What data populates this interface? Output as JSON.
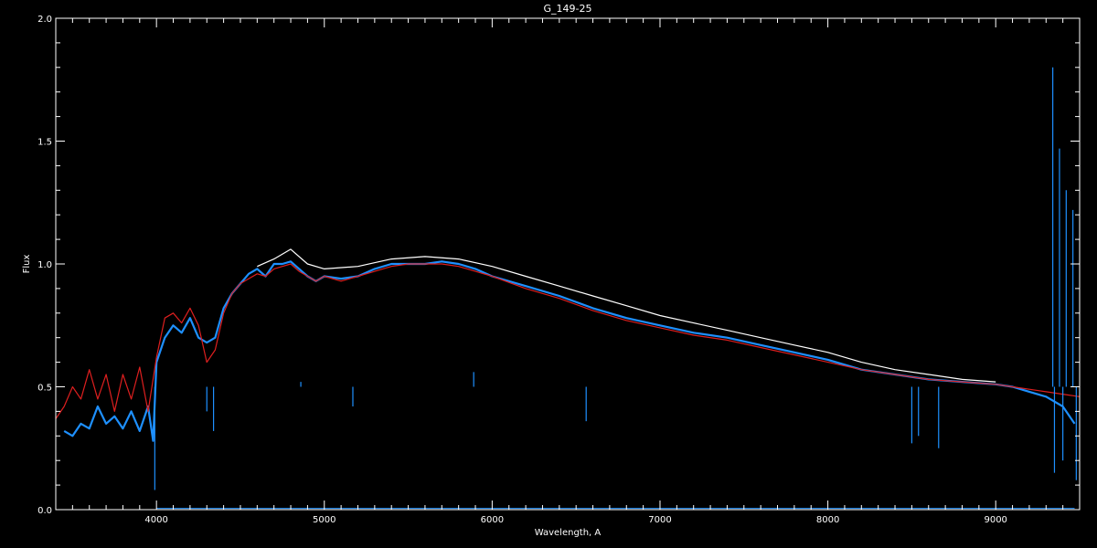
{
  "chart_data": {
    "type": "line",
    "title": "G_149-25",
    "xlabel": "Wavelength, A",
    "ylabel": "Flux",
    "xlim": [
      3400,
      9500
    ],
    "ylim": [
      0.0,
      2.0
    ],
    "x_ticks": [
      4000,
      5000,
      6000,
      7000,
      8000,
      9000
    ],
    "x_tick_labels": [
      "4000",
      "5000",
      "6000",
      "7000",
      "8000",
      "9000"
    ],
    "y_ticks": [
      0.0,
      0.5,
      1.0,
      1.5,
      2.0
    ],
    "y_tick_labels": [
      "0.0",
      "0.5",
      "1.0",
      "1.5",
      "2.0"
    ],
    "x_minor_step": 100,
    "y_minor_step": 0.1,
    "grid": false,
    "legend": "none",
    "colors": {
      "background": "#000000",
      "axes": "#ffffff",
      "observed": "#1e90ff",
      "model": "#dd1f1f",
      "continuum": "#ffffff"
    },
    "series": [
      {
        "color": "#1e90ff",
        "x": [
          3450,
          3500,
          3550,
          3600,
          3650,
          3700,
          3750,
          3800,
          3850,
          3900,
          3950,
          3980,
          4000,
          4050,
          4100,
          4150,
          4200,
          4250,
          4300,
          4350,
          4400,
          4450,
          4500,
          4550,
          4600,
          4650,
          4700,
          4750,
          4800,
          4850,
          4900,
          4950,
          5000,
          5100,
          5200,
          5300,
          5400,
          5500,
          5600,
          5700,
          5800,
          5900,
          6000,
          6200,
          6400,
          6600,
          6800,
          7000,
          7200,
          7400,
          7600,
          7800,
          8000,
          8200,
          8400,
          8600,
          8800,
          9000,
          9100,
          9200,
          9300,
          9400,
          9470
        ],
        "y": [
          0.32,
          0.3,
          0.35,
          0.33,
          0.42,
          0.35,
          0.38,
          0.33,
          0.4,
          0.32,
          0.42,
          0.28,
          0.6,
          0.7,
          0.75,
          0.72,
          0.78,
          0.7,
          0.68,
          0.7,
          0.82,
          0.88,
          0.92,
          0.96,
          0.98,
          0.95,
          1.0,
          1.0,
          1.01,
          0.98,
          0.95,
          0.93,
          0.95,
          0.94,
          0.95,
          0.98,
          1.0,
          1.0,
          1.0,
          1.01,
          1.0,
          0.98,
          0.95,
          0.91,
          0.87,
          0.82,
          0.78,
          0.75,
          0.72,
          0.7,
          0.67,
          0.64,
          0.61,
          0.57,
          0.55,
          0.53,
          0.52,
          0.51,
          0.5,
          0.48,
          0.46,
          0.42,
          0.35
        ]
      },
      {
        "color": "#dd1f1f",
        "x": [
          3400,
          3450,
          3500,
          3550,
          3600,
          3650,
          3700,
          3750,
          3800,
          3850,
          3900,
          3950,
          4000,
          4050,
          4100,
          4150,
          4200,
          4250,
          4300,
          4350,
          4400,
          4450,
          4500,
          4550,
          4600,
          4650,
          4700,
          4750,
          4800,
          4850,
          4900,
          4950,
          5000,
          5100,
          5200,
          5300,
          5400,
          5500,
          5600,
          5700,
          5800,
          5900,
          6000,
          6200,
          6400,
          6600,
          6800,
          7000,
          7200,
          7400,
          7600,
          7800,
          8000,
          8200,
          8400,
          8600,
          8800,
          9000,
          9100,
          9200,
          9300,
          9400,
          9500
        ],
        "y": [
          0.37,
          0.42,
          0.5,
          0.45,
          0.57,
          0.45,
          0.55,
          0.4,
          0.55,
          0.45,
          0.58,
          0.4,
          0.62,
          0.78,
          0.8,
          0.76,
          0.82,
          0.75,
          0.6,
          0.65,
          0.8,
          0.88,
          0.92,
          0.94,
          0.96,
          0.95,
          0.98,
          0.99,
          1.0,
          0.97,
          0.95,
          0.93,
          0.95,
          0.93,
          0.95,
          0.97,
          0.99,
          1.0,
          1.0,
          1.0,
          0.99,
          0.97,
          0.95,
          0.9,
          0.86,
          0.81,
          0.77,
          0.74,
          0.71,
          0.69,
          0.66,
          0.63,
          0.6,
          0.57,
          0.55,
          0.53,
          0.52,
          0.51,
          0.5,
          0.49,
          0.48,
          0.47,
          0.46
        ]
      },
      {
        "color": "#ffffff",
        "x": [
          4600,
          4700,
          4800,
          4900,
          5000,
          5200,
          5400,
          5600,
          5800,
          6000,
          6200,
          6400,
          6600,
          6800,
          7000,
          7200,
          7400,
          7600,
          7800,
          8000,
          8200,
          8400,
          8600,
          8800,
          9000
        ],
        "y": [
          0.99,
          1.02,
          1.06,
          1.0,
          0.98,
          0.99,
          1.02,
          1.03,
          1.02,
          0.99,
          0.95,
          0.91,
          0.87,
          0.83,
          0.79,
          0.76,
          0.73,
          0.7,
          0.67,
          0.64,
          0.6,
          0.57,
          0.55,
          0.53,
          0.52
        ]
      }
    ],
    "spikes": [
      {
        "x": 3990,
        "y": 0.08
      },
      {
        "x": 4300,
        "y": 0.4
      },
      {
        "x": 4340,
        "y": 0.32
      },
      {
        "x": 4860,
        "y": 0.52
      },
      {
        "x": 5170,
        "y": 0.42
      },
      {
        "x": 5180,
        "y": 0.5
      },
      {
        "x": 5890,
        "y": 0.56
      },
      {
        "x": 6560,
        "y": 0.36
      },
      {
        "x": 8500,
        "y": 0.27
      },
      {
        "x": 8540,
        "y": 0.3
      },
      {
        "x": 8660,
        "y": 0.25
      },
      {
        "x": 9340,
        "y": 1.8
      },
      {
        "x": 9350,
        "y": 0.15
      },
      {
        "x": 9380,
        "y": 1.47
      },
      {
        "x": 9400,
        "y": 0.2
      },
      {
        "x": 9420,
        "y": 1.3
      },
      {
        "x": 9460,
        "y": 1.22
      },
      {
        "x": 9480,
        "y": 0.12
      }
    ]
  }
}
